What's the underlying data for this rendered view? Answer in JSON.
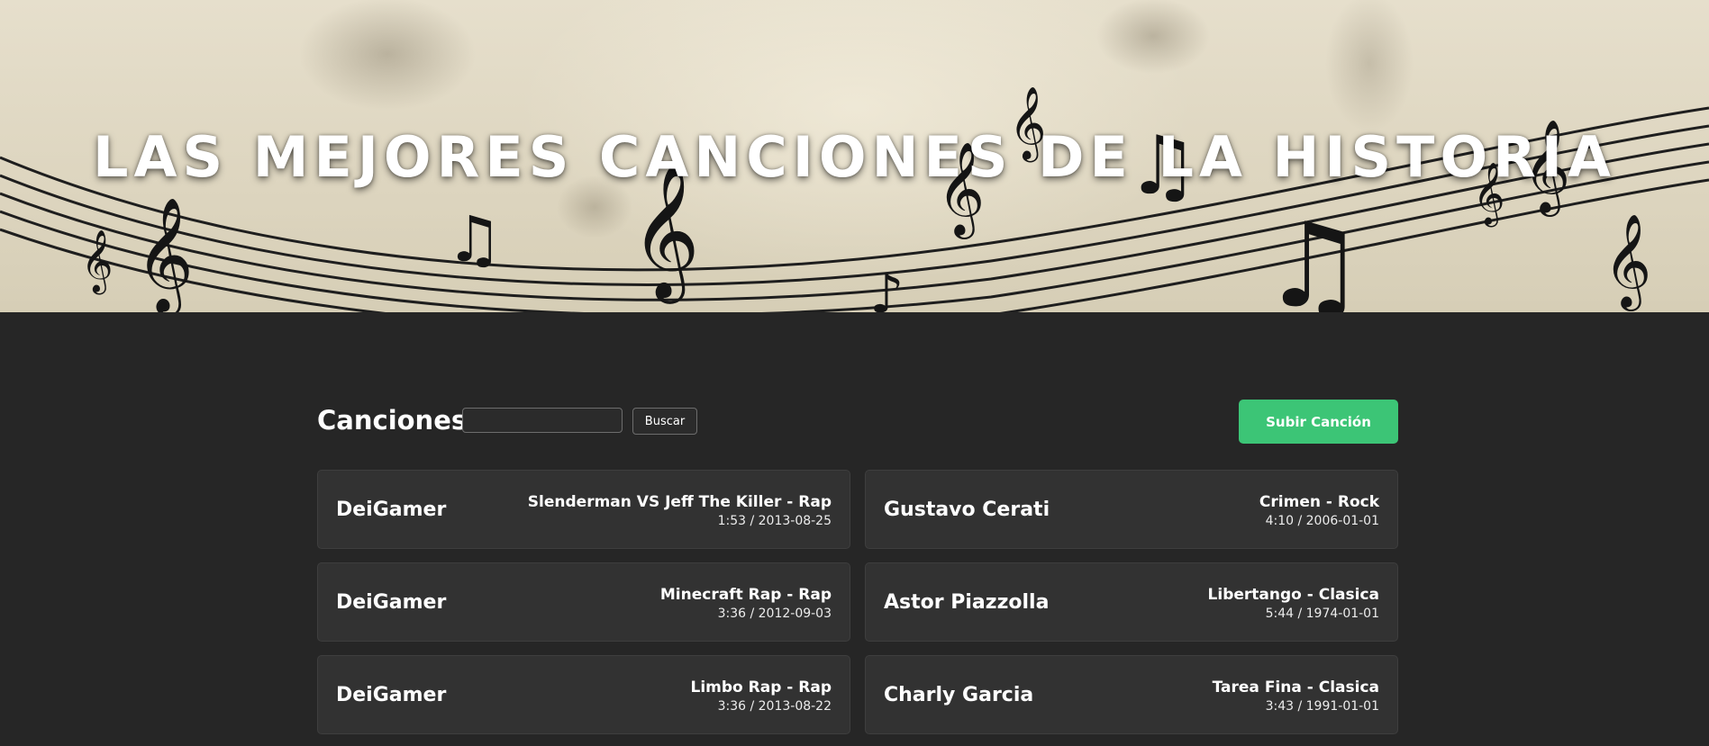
{
  "hero": {
    "title": "LAS MEJORES CANCIONES DE LA HISTORIA"
  },
  "toolbar": {
    "heading": "Canciones",
    "search_placeholder": "",
    "search_button": "Buscar",
    "upload_button": "Subir Canción"
  },
  "songs": [
    {
      "artist": "DeiGamer",
      "title": "Slenderman VS Jeff The Killer - Rap",
      "meta": "1:53 / 2013-08-25"
    },
    {
      "artist": "Gustavo Cerati",
      "title": "Crimen - Rock",
      "meta": "4:10 / 2006-01-01"
    },
    {
      "artist": "DeiGamer",
      "title": "Minecraft Rap - Rap",
      "meta": "3:36 / 2012-09-03"
    },
    {
      "artist": "Astor Piazzolla",
      "title": "Libertango - Clasica",
      "meta": "5:44 / 1974-01-01"
    },
    {
      "artist": "DeiGamer",
      "title": "Limbo Rap - Rap",
      "meta": "3:36 / 2013-08-22"
    },
    {
      "artist": "Charly Garcia",
      "title": "Tarea Fina - Clasica",
      "meta": "3:43 / 1991-01-01"
    }
  ],
  "colors": {
    "background": "#262626",
    "card": "#323232",
    "accent": "#3cc576"
  }
}
